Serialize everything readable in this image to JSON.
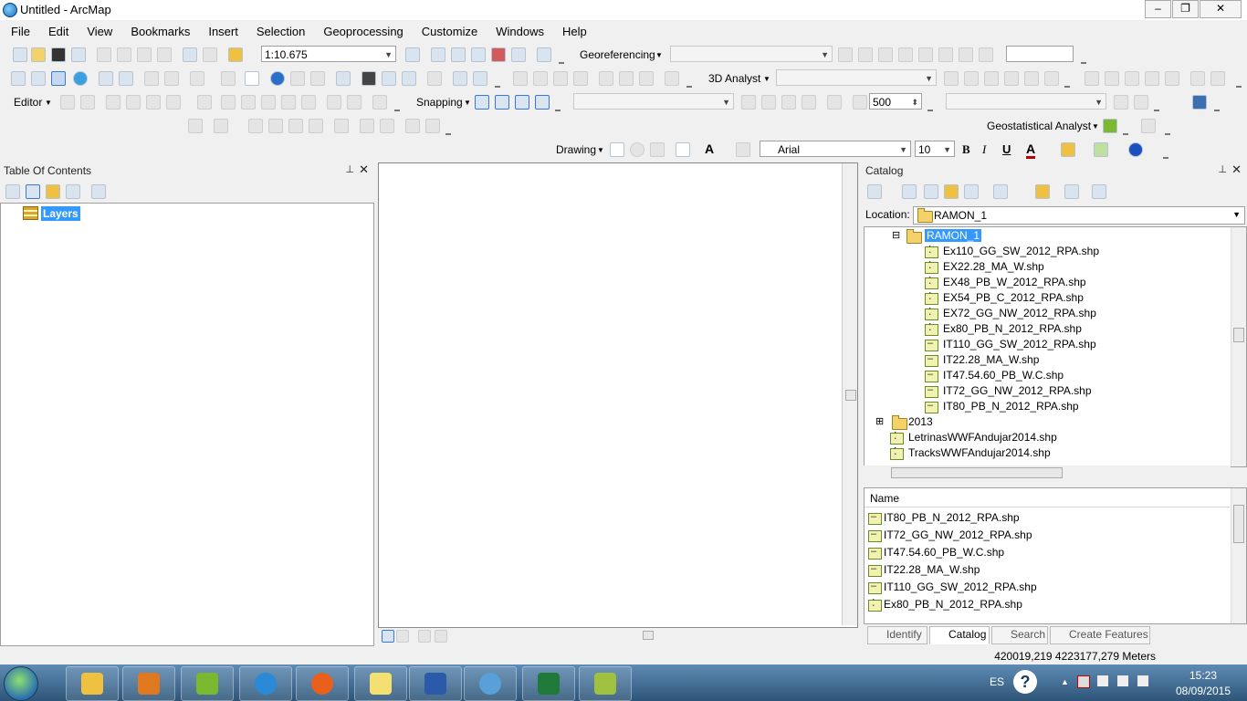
{
  "window": {
    "title": "Untitled - ArcMap"
  },
  "menu": [
    "File",
    "Edit",
    "View",
    "Bookmarks",
    "Insert",
    "Selection",
    "Geoprocessing",
    "Customize",
    "Windows",
    "Help"
  ],
  "toolbars": {
    "scale": "1:10.675",
    "georeferencing": "Georeferencing",
    "analyst3d": "3D Analyst",
    "editor": "Editor",
    "snapping": "Snapping",
    "value500": "500",
    "geostat": "Geostatistical Analyst",
    "drawing": "Drawing",
    "font": "Arial",
    "fontsize": "10",
    "bold": "B",
    "italic": "I",
    "underline": "U",
    "fontcolor": "A"
  },
  "toc": {
    "title": "Table Of Contents",
    "root": "Layers"
  },
  "catalog": {
    "title": "Catalog",
    "location_label": "Location:",
    "location_value": "RAMON_1",
    "tree": {
      "folder": "RAMON_1",
      "files": [
        {
          "name": "Ex110_GG_SW_2012_RPA.shp",
          "type": "point"
        },
        {
          "name": "EX22.28_MA_W.shp",
          "type": "point"
        },
        {
          "name": "EX48_PB_W_2012_RPA.shp",
          "type": "point"
        },
        {
          "name": "EX54_PB_C_2012_RPA.shp",
          "type": "point"
        },
        {
          "name": "EX72_GG_NW_2012_RPA.shp",
          "type": "point"
        },
        {
          "name": "Ex80_PB_N_2012_RPA.shp",
          "type": "point"
        },
        {
          "name": "IT110_GG_SW_2012_RPA.shp",
          "type": "line"
        },
        {
          "name": "IT22.28_MA_W.shp",
          "type": "line"
        },
        {
          "name": "IT47.54.60_PB_W.C.shp",
          "type": "line"
        },
        {
          "name": "IT72_GG_NW_2012_RPA.shp",
          "type": "line"
        },
        {
          "name": "IT80_PB_N_2012_RPA.shp",
          "type": "line"
        }
      ],
      "folder2": "2013",
      "extras": [
        {
          "name": "LetrinasWWFAndujar2014.shp",
          "type": "point"
        },
        {
          "name": "TracksWWFAndujar2014.shp",
          "type": "point"
        }
      ]
    },
    "contents_header": "Name",
    "contents": [
      {
        "name": "IT80_PB_N_2012_RPA.shp",
        "type": "line"
      },
      {
        "name": "IT72_GG_NW_2012_RPA.shp",
        "type": "line"
      },
      {
        "name": "IT47.54.60_PB_W.C.shp",
        "type": "line"
      },
      {
        "name": "IT22.28_MA_W.shp",
        "type": "line"
      },
      {
        "name": "IT110_GG_SW_2012_RPA.shp",
        "type": "line"
      },
      {
        "name": "Ex80_PB_N_2012_RPA.shp",
        "type": "point"
      }
    ],
    "tabs": [
      "Identify",
      "Catalog",
      "Search",
      "Create Features"
    ]
  },
  "status": {
    "coords": "420019,219  4223177,279 Meters"
  },
  "taskbar": {
    "lang": "ES",
    "time": "15:23",
    "date": "08/09/2015"
  }
}
